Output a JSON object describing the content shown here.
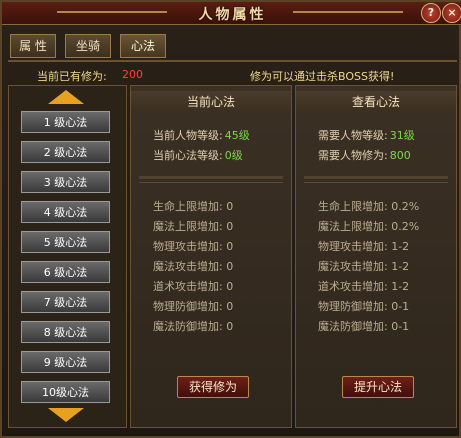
{
  "window": {
    "title": "人物属性",
    "help_label": "?",
    "close_label": "×"
  },
  "tabs": [
    {
      "label": "属 性"
    },
    {
      "label": "坐骑"
    },
    {
      "label": "心法"
    }
  ],
  "cultivation": {
    "label": "当前已有修为:",
    "value": "200",
    "hint": "修为可以通过击杀BOSS获得!"
  },
  "levels": [
    {
      "label": "1 级心法"
    },
    {
      "label": "2 级心法"
    },
    {
      "label": "3 级心法"
    },
    {
      "label": "4 级心法"
    },
    {
      "label": "5 级心法"
    },
    {
      "label": "6 级心法"
    },
    {
      "label": "7 级心法"
    },
    {
      "label": "8 级心法"
    },
    {
      "label": "9 级心法"
    },
    {
      "label": "10级心法"
    }
  ],
  "current": {
    "header": "当前心法",
    "char_level_label": "当前人物等级:",
    "char_level_value": "45级",
    "skill_level_label": "当前心法等级:",
    "skill_level_value": "0级",
    "stats": [
      {
        "label": "生命上限增加:",
        "value": "0"
      },
      {
        "label": "魔法上限增加:",
        "value": "0"
      },
      {
        "label": "物理攻击增加:",
        "value": "0"
      },
      {
        "label": "魔法攻击增加:",
        "value": "0"
      },
      {
        "label": "道术攻击增加:",
        "value": "0"
      },
      {
        "label": "物理防御增加:",
        "value": "0"
      },
      {
        "label": "魔法防御增加:",
        "value": "0"
      }
    ],
    "button_label": "获得修为"
  },
  "view": {
    "header": "查看心法",
    "req_level_label": "需要人物等级:",
    "req_level_value": "31级",
    "req_cult_label": "需要人物修为:",
    "req_cult_value": "800",
    "stats": [
      {
        "label": "生命上限增加:",
        "value": "0.2%"
      },
      {
        "label": "魔法上限增加:",
        "value": "0.2%"
      },
      {
        "label": "物理攻击增加:",
        "value": "1-2"
      },
      {
        "label": "魔法攻击增加:",
        "value": "1-2"
      },
      {
        "label": "道术攻击增加:",
        "value": "1-2"
      },
      {
        "label": "物理防御增加:",
        "value": "0-1"
      },
      {
        "label": "魔法防御增加:",
        "value": "0-1"
      }
    ],
    "button_label": "提升心法"
  },
  "colors": {
    "highlight_green": "#7ad84a",
    "cultivation_red": "#ff4030",
    "arrow_gold": "#e8a020"
  }
}
